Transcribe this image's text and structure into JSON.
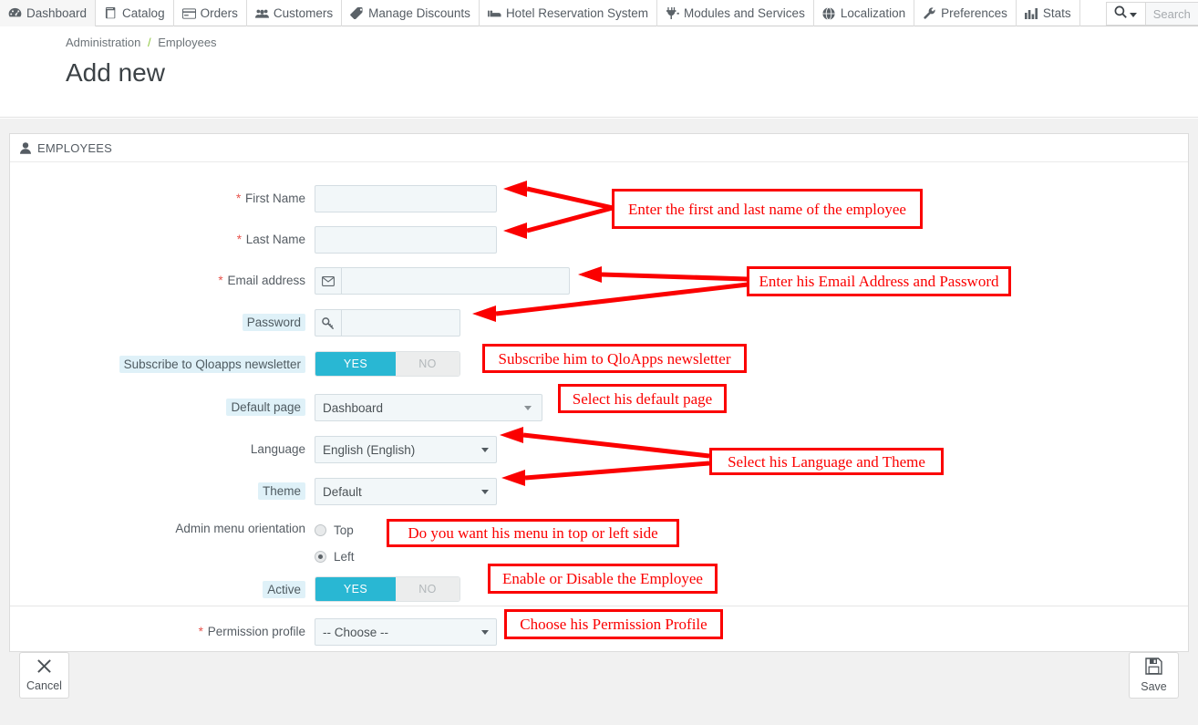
{
  "topnav": {
    "items": [
      {
        "label": "Dashboard",
        "icon": "dashboard-icon"
      },
      {
        "label": "Catalog",
        "icon": "book-icon"
      },
      {
        "label": "Orders",
        "icon": "orders-icon"
      },
      {
        "label": "Customers",
        "icon": "customers-icon"
      },
      {
        "label": "Manage Discounts",
        "icon": "tag-icon"
      },
      {
        "label": "Hotel Reservation System",
        "icon": "bed-icon"
      },
      {
        "label": "Modules and Services",
        "icon": "plug-icon"
      },
      {
        "label": "Localization",
        "icon": "globe-icon"
      },
      {
        "label": "Preferences",
        "icon": "wrench-icon"
      },
      {
        "label": "Stats",
        "icon": "chart-icon"
      }
    ],
    "search": {
      "placeholder": "Search",
      "icon": "search-icon"
    },
    "more": {
      "label": "•••",
      "icon": "kebab-icon"
    }
  },
  "header": {
    "breadcrumb_parent": "Administration",
    "breadcrumb_sep": "/",
    "breadcrumb_current": "Employees",
    "title": "Add new"
  },
  "panel": {
    "header_title": "EMPLOYEES",
    "header_icon": "user-icon"
  },
  "form": {
    "first_name": {
      "label": "First Name",
      "required": true,
      "value": "",
      "placeholder": ""
    },
    "last_name": {
      "label": "Last Name",
      "required": true,
      "value": "",
      "placeholder": ""
    },
    "email": {
      "label": "Email address",
      "required": true,
      "value": "",
      "placeholder": "",
      "icon": "envelope-icon"
    },
    "password": {
      "label": "Password",
      "required": false,
      "value": "",
      "placeholder": "",
      "icon": "key-icon",
      "hinted": true
    },
    "newsletter": {
      "label": "Subscribe to Qloapps newsletter",
      "yes": "YES",
      "no": "NO",
      "selected": "YES",
      "hinted": true
    },
    "default_page": {
      "label": "Default page",
      "value": "Dashboard",
      "hinted": true
    },
    "language": {
      "label": "Language",
      "value": "English (English)"
    },
    "theme": {
      "label": "Theme",
      "value": "Default",
      "hinted": true
    },
    "menu_orientation": {
      "label": "Admin menu orientation",
      "options": [
        {
          "label": "Top",
          "selected": false
        },
        {
          "label": "Left",
          "selected": true
        }
      ]
    },
    "active": {
      "label": "Active",
      "yes": "YES",
      "no": "NO",
      "selected": "YES",
      "hinted": true
    },
    "permission_profile": {
      "label": "Permission profile",
      "required": true,
      "value": "-- Choose --"
    }
  },
  "footer": {
    "cancel": {
      "label": "Cancel",
      "icon": "close-x-icon"
    },
    "save": {
      "label": "Save",
      "icon": "floppy-disk-icon"
    }
  },
  "annotations": [
    {
      "id": "a-names",
      "text": "Enter the first and last name of the employee"
    },
    {
      "id": "a-email",
      "text": "Enter his Email Address and Password"
    },
    {
      "id": "a-newsletter",
      "text": "Subscribe him to QloApps newsletter"
    },
    {
      "id": "a-defaultpage",
      "text": "Select his default page"
    },
    {
      "id": "a-langtheme",
      "text": "Select his Language and Theme"
    },
    {
      "id": "a-menu",
      "text": "Do you want his menu in top or left side"
    },
    {
      "id": "a-active",
      "text": "Enable or Disable the Employee"
    },
    {
      "id": "a-profile",
      "text": "Choose his Permission Profile"
    }
  ],
  "colors": {
    "annotation_red": "#fb0000",
    "toggle_on_cyan": "#29b7d3",
    "required_star": "#e8544d",
    "breadcrumb_sep_green": "#8ec73f",
    "hint_bg": "#dff1f8"
  }
}
